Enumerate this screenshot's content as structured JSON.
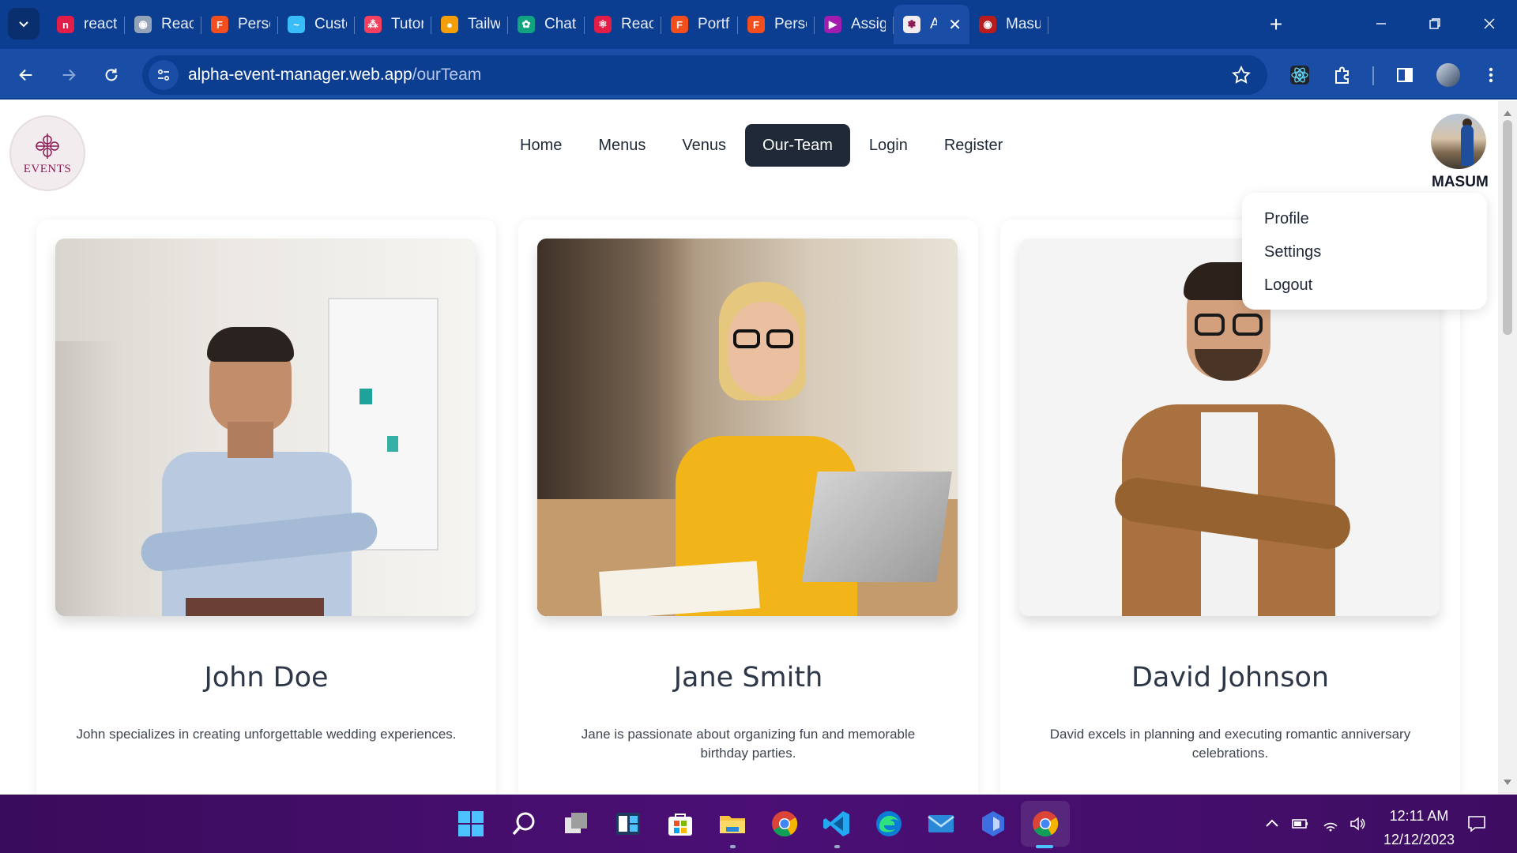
{
  "browser": {
    "tabs": [
      {
        "label": "react-",
        "color": "#e11d48",
        "glyph": "n"
      },
      {
        "label": "React",
        "color": "#94a3b8",
        "glyph": "◉"
      },
      {
        "label": "Perso",
        "color": "#f24e1e",
        "glyph": "F"
      },
      {
        "label": "Custo",
        "color": "#38bdf8",
        "glyph": "~"
      },
      {
        "label": "Tutori",
        "color": "#f43f5e",
        "glyph": "⁂"
      },
      {
        "label": "Tailwi",
        "color": "#f59e0b",
        "glyph": "●"
      },
      {
        "label": "ChatG",
        "color": "#10a37f",
        "glyph": "✿"
      },
      {
        "label": "React",
        "color": "#e11d48",
        "glyph": "⚛"
      },
      {
        "label": "Portfo",
        "color": "#f24e1e",
        "glyph": "F"
      },
      {
        "label": "Perso",
        "color": "#f24e1e",
        "glyph": "F"
      },
      {
        "label": "Assig",
        "color": "#a21caf",
        "glyph": "▶"
      },
      {
        "label": "A",
        "color": "#f3ecee",
        "glyph": "✽",
        "active": true
      },
      {
        "label": "Masu",
        "color": "#b91c1c",
        "glyph": "◉"
      }
    ],
    "url_host": "alpha-event-manager.web.app",
    "url_path": "/ourTeam"
  },
  "page": {
    "logo_text": "EVENTS",
    "nav": [
      {
        "label": "Home"
      },
      {
        "label": "Menus"
      },
      {
        "label": "Venus"
      },
      {
        "label": "Our-Team",
        "active": true
      },
      {
        "label": "Login"
      },
      {
        "label": "Register"
      }
    ],
    "user": {
      "name": "MASUM"
    },
    "dropdown": [
      "Profile",
      "Settings",
      "Logout"
    ],
    "team": [
      {
        "name": "John Doe",
        "desc": "John specializes in creating unforgettable wedding experiences."
      },
      {
        "name": "Jane Smith",
        "desc": "Jane is passionate about organizing fun and memorable birthday parties."
      },
      {
        "name": "David Johnson",
        "desc": "David excels in planning and executing romantic anniversary celebrations."
      }
    ]
  },
  "taskbar": {
    "time": "12:11 AM",
    "date": "12/12/2023"
  },
  "colors": {
    "tabbar": "#0b3d91",
    "addrbar": "#1a4ea6",
    "nav_active": "#1f2937",
    "taskbar": "#4b0f75"
  }
}
